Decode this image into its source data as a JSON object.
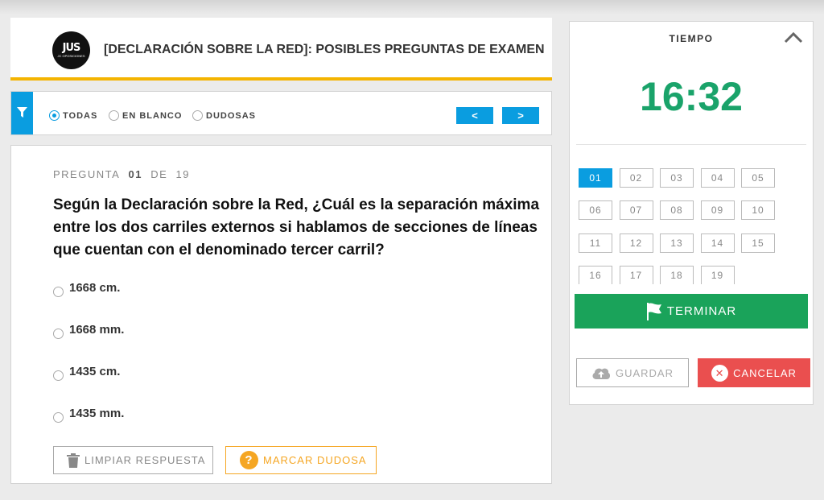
{
  "header": {
    "logo_text": "JUS",
    "logo_subtext": "JC OPOSICIONES",
    "title": "[DECLARACIÓN SOBRE LA RED]: POSIBLES PREGUNTAS DE EXAMEN"
  },
  "filter": {
    "options": [
      {
        "label": "TODAS",
        "selected": true
      },
      {
        "label": "EN BLANCO",
        "selected": false
      },
      {
        "label": "DUDOSAS",
        "selected": false
      }
    ],
    "prev_label": "<",
    "next_label": ">"
  },
  "question": {
    "meta_prefix": "PREGUNTA",
    "number": "01",
    "meta_of": "DE",
    "total": "19",
    "text": "Según la Declaración sobre la Red, ¿Cuál es la separación máxima entre los dos carriles externos si hablamos de secciones de líneas que cuentan con el denominado tercer carril?",
    "answers": [
      "1668 cm.",
      "1668 mm.",
      "1435 cm.",
      "1435 mm."
    ],
    "clear_label": "LIMPIAR RESPUESTA",
    "doubt_icon": "?",
    "doubt_label": "MARCAR DUDOSA"
  },
  "side": {
    "time_label": "TIEMPO",
    "timer": "16:32",
    "question_numbers": [
      "01",
      "02",
      "03",
      "04",
      "05",
      "06",
      "07",
      "08",
      "09",
      "10",
      "11",
      "12",
      "13",
      "14",
      "15",
      "16",
      "17",
      "18",
      "19"
    ],
    "active_question": "01",
    "finish_label": "TERMINAR",
    "save_label": "GUARDAR",
    "cancel_icon": "✕",
    "cancel_label": "CANCELAR"
  },
  "colors": {
    "accent_blue": "#0a9de0",
    "timer_green": "#1aa36a",
    "finish_green": "#1aa35a",
    "header_underline": "#f4b400",
    "doubt_orange": "#f5a623",
    "cancel_red": "#ea4f4f"
  }
}
